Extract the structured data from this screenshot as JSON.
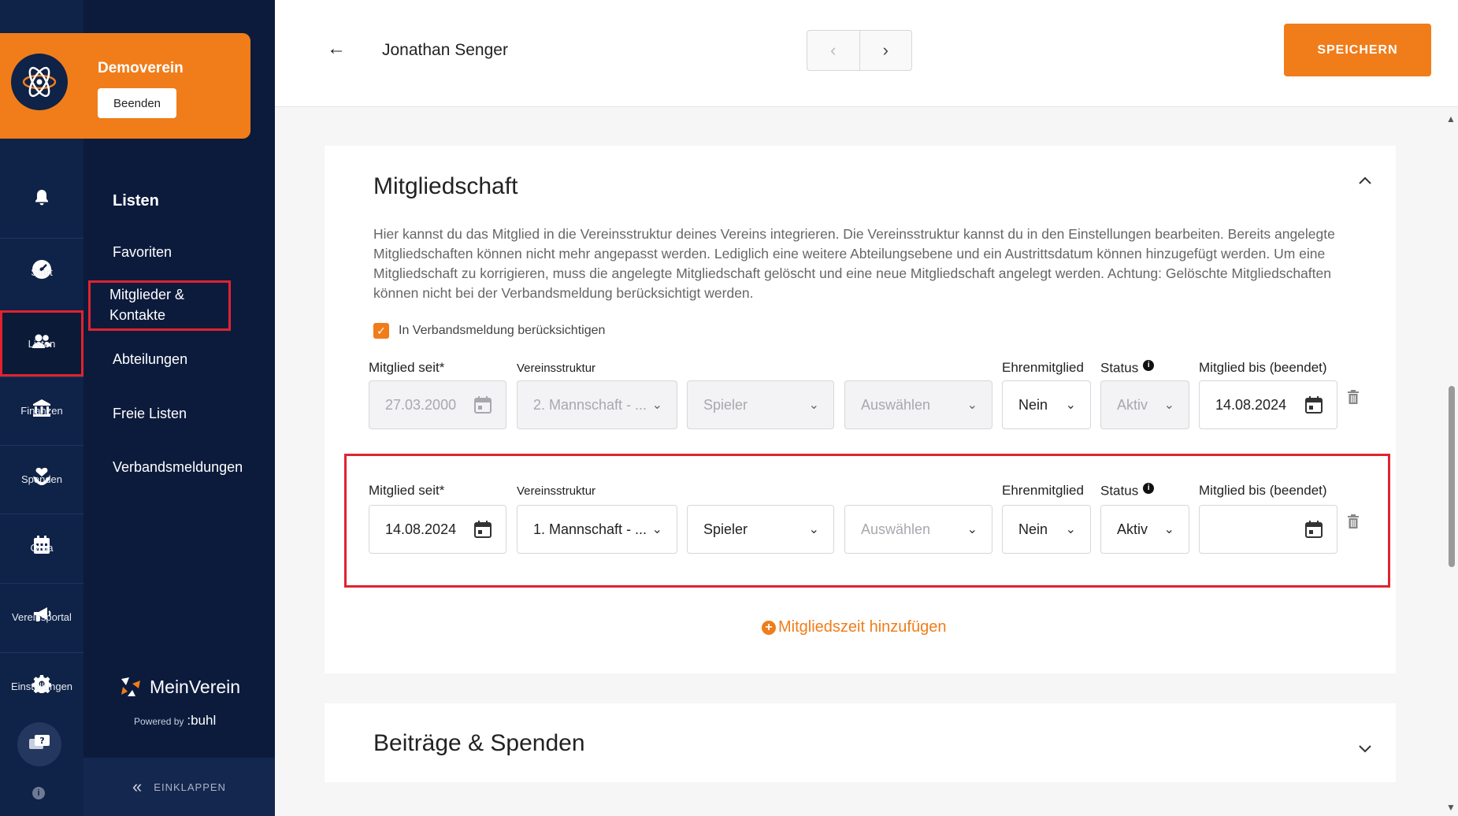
{
  "org": {
    "name": "Demoverein",
    "end_button": "Beenden"
  },
  "rail": {
    "items": [
      {
        "label": "Start",
        "icon": "dashboard-icon"
      },
      {
        "label": "Listen",
        "icon": "users-icon"
      },
      {
        "label": "Finanzen",
        "icon": "bank-icon"
      },
      {
        "label": "Spenden",
        "icon": "donation-icon"
      },
      {
        "label": "Orga",
        "icon": "calendar-icon"
      },
      {
        "label": "Vereinsportal",
        "icon": "megaphone-icon"
      },
      {
        "label": "Einstellungen",
        "icon": "gear-icon"
      }
    ]
  },
  "panel": {
    "title": "Listen",
    "links": [
      "Favoriten",
      "Mitglieder &",
      "Kontakte",
      "Abteilungen",
      "Freie Listen",
      "Verbandsmeldungen"
    ],
    "brand": "MeinVerein",
    "powered": "Powered by",
    "powered_brand": ":buhl",
    "collapse": "EINKLAPPEN"
  },
  "header": {
    "member_name": "Jonathan Senger",
    "save_label": "SPEICHERN"
  },
  "membership": {
    "title": "Mitgliedschaft",
    "description": "Hier kannst du das Mitglied in die Vereinsstruktur deines Vereins integrieren. Die Vereinsstruktur kannst du in den Einstellungen bearbeiten. Bereits angelegte Mitgliedschaften können nicht mehr angepasst werden. Lediglich eine weitere Abteilungsebene und ein Austrittsdatum können hinzugefügt werden. Um eine Mitgliedschaft zu korrigieren, muss die angelegte Mitgliedschaft gelöscht und eine neue Mitgliedschaft angelegt werden. Achtung: Gelöschte Mitgliedschaften können nicht bei der Verbandsmeldung berücksichtigt werden.",
    "checkbox_label": "In Verbandsmeldung berücksichtigen",
    "labels": {
      "since": "Mitglied seit*",
      "structure": "Vereinsstruktur",
      "honorary": "Ehrenmitglied",
      "status": "Status",
      "until": "Mitglied bis (beendet)"
    },
    "rows": [
      {
        "since": "27.03.2000",
        "structure": "2. Mannschaft - ...",
        "role": "Spieler",
        "select": "Auswählen",
        "honorary": "Nein",
        "status": "Aktiv",
        "until": "14.08.2024"
      },
      {
        "since": "14.08.2024",
        "structure": "1. Mannschaft - ...",
        "role": "Spieler",
        "select": "Auswählen",
        "honorary": "Nein",
        "status": "Aktiv",
        "until": ""
      }
    ],
    "add_label": "Mitgliedszeit hinzufügen"
  },
  "fees": {
    "title": "Beiträge & Spenden"
  },
  "colors": {
    "accent": "#f07d1a",
    "navy": "#0f2247",
    "highlight": "#e0232f"
  }
}
